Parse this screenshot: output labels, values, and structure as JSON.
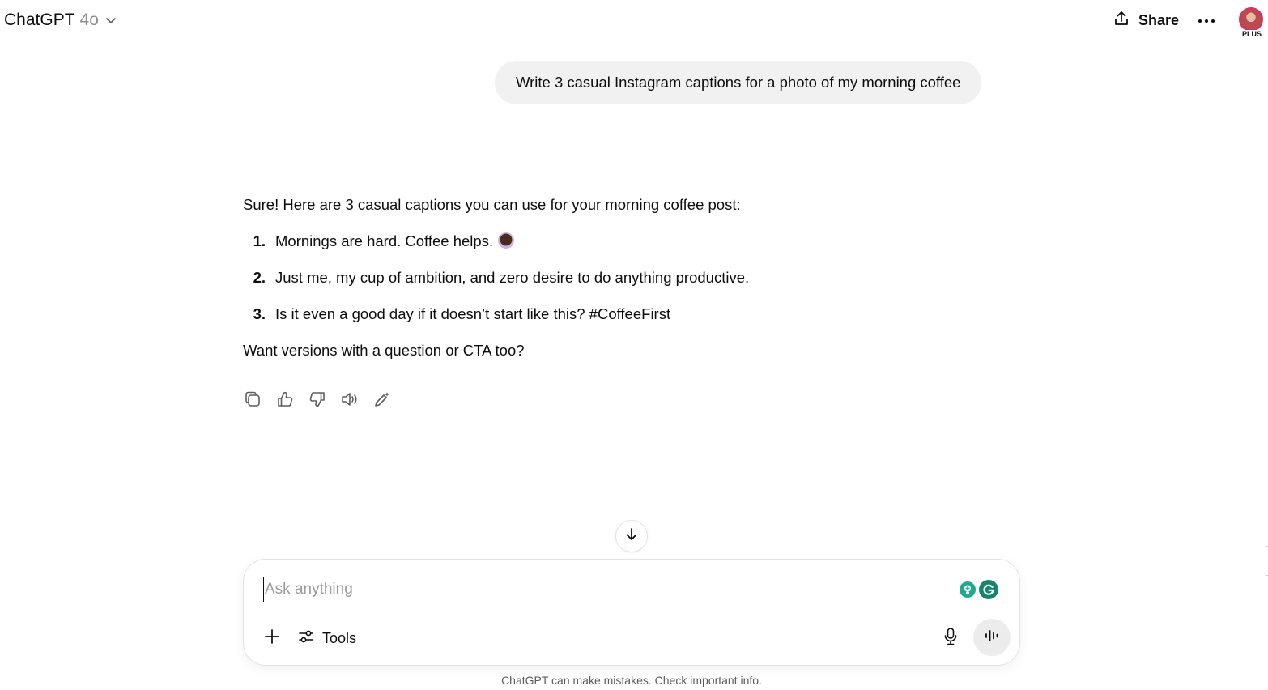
{
  "header": {
    "app_name": "ChatGPT",
    "model_name": "4o",
    "share_label": "Share",
    "plan_badge": "PLUS"
  },
  "conversation": {
    "user_message": "Write 3 casual Instagram captions for a photo of my morning coffee",
    "assistant": {
      "intro": "Sure! Here are 3 casual captions you can use for your morning coffee post:",
      "captions": [
        {
          "num": "1.",
          "text": "Mornings are hard. Coffee helps."
        },
        {
          "num": "2.",
          "text": "Just me, my cup of ambition, and zero desire to do anything productive."
        },
        {
          "num": "3.",
          "text": "Is it even a good day if it doesn’t start like this? #CoffeeFirst"
        }
      ],
      "followup": "Want versions with a question or CTA too?"
    }
  },
  "composer": {
    "placeholder": "Ask anything",
    "value": "",
    "tools_label": "Tools"
  },
  "footer": {
    "disclaimer": "ChatGPT can make mistakes. Check important info."
  },
  "icons": {
    "chevron": "chevron-down-icon",
    "share": "share-icon",
    "more": "more-horizontal-icon",
    "copy": "copy-icon",
    "thumbs_up": "thumbs-up-icon",
    "thumbs_down": "thumbs-down-icon",
    "read_aloud": "speaker-icon",
    "edit": "edit-pencil-icon",
    "scroll_down": "arrow-down-icon",
    "plus": "plus-icon",
    "tools": "sliders-icon",
    "mic": "microphone-icon",
    "voice": "voice-waveform-icon",
    "grammarly_bulb": "grammarly-bulb-icon",
    "grammarly_g": "grammarly-g-icon",
    "coffee_emoji": "hot-beverage-emoji"
  },
  "colors": {
    "user_bubble": "#f1f1f1",
    "text": "#0d0d0d",
    "muted": "#8f8f8f",
    "grammarly": "#15856b",
    "voice_button": "#ececec"
  }
}
